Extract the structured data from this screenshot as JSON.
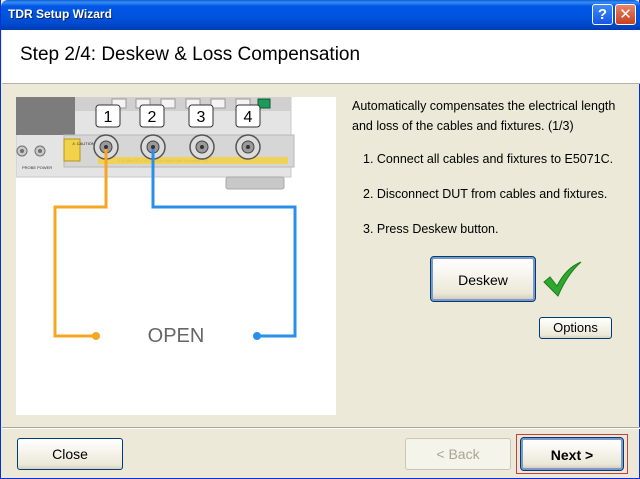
{
  "window": {
    "title": "TDR Setup Wizard"
  },
  "titlebar": {
    "help_glyph": "?",
    "close_glyph": "✕"
  },
  "header": {
    "title": "Step 2/4: Deskew & Loss Compensation"
  },
  "diagram": {
    "ports": [
      "1",
      "2",
      "3",
      "4"
    ],
    "open_label": "OPEN",
    "probe_power_label": "PROBE POWER",
    "caution_label": "⚠ CAUTION",
    "panel_note": "± 28 dBm RF  ± 35 VDC Max     Avoid Static Discharge CAT 1",
    "cable_colors": {
      "port1": "#f5a623",
      "port2": "#2a8fe8"
    }
  },
  "instructions": {
    "intro": "Automatically compensates the electrical length and loss of the cables and fixtures.  (1/3)",
    "steps": [
      "1. Connect all cables and fixtures to E5071C.",
      "2. Disconnect DUT from cables and fixtures.",
      "3. Press Deskew button."
    ]
  },
  "buttons": {
    "deskew": "Deskew",
    "options": "Options",
    "close": "Close",
    "back": "< Back",
    "next": "Next >"
  },
  "status": {
    "deskew_done_icon": "checkmark-icon"
  }
}
